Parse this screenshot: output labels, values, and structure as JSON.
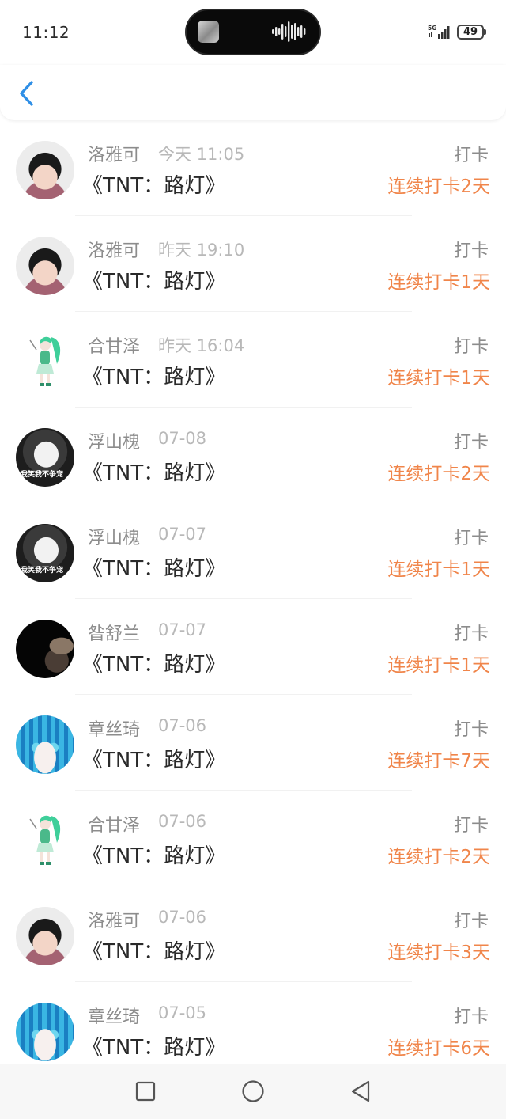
{
  "status_bar": {
    "time": "11:12",
    "network": "5G",
    "battery": "49"
  },
  "header": {
    "back_icon": "chevron-left-icon"
  },
  "colors": {
    "accent_blue": "#2f8fe6",
    "streak_orange": "#f0854a",
    "secondary_text": "#8c8c8c",
    "date_text": "#b8b8b8",
    "title_text": "#2a2a2a"
  },
  "records": [
    {
      "name": "洛雅可",
      "date": "今天 11:05",
      "title": "《TNT：路灯》",
      "action": "打卡",
      "streak": "连续打卡2天"
    },
    {
      "name": "洛雅可",
      "date": "昨天 19:10",
      "title": "《TNT：路灯》",
      "action": "打卡",
      "streak": "连续打卡1天"
    },
    {
      "name": "合甘泽",
      "date": "昨天 16:04",
      "title": "《TNT：路灯》",
      "action": "打卡",
      "streak": "连续打卡1天"
    },
    {
      "name": "浮山槐",
      "date": "07-08",
      "title": "《TNT：路灯》",
      "action": "打卡",
      "streak": "连续打卡2天"
    },
    {
      "name": "浮山槐",
      "date": "07-07",
      "title": "《TNT：路灯》",
      "action": "打卡",
      "streak": "连续打卡1天"
    },
    {
      "name": "昝舒兰",
      "date": "07-07",
      "title": "《TNT：路灯》",
      "action": "打卡",
      "streak": "连续打卡1天"
    },
    {
      "name": "章丝琦",
      "date": "07-06",
      "title": "《TNT：路灯》",
      "action": "打卡",
      "streak": "连续打卡7天"
    },
    {
      "name": "合甘泽",
      "date": "07-06",
      "title": "《TNT：路灯》",
      "action": "打卡",
      "streak": "连续打卡2天"
    },
    {
      "name": "洛雅可",
      "date": "07-06",
      "title": "《TNT：路灯》",
      "action": "打卡",
      "streak": "连续打卡3天"
    },
    {
      "name": "章丝琦",
      "date": "07-05",
      "title": "《TNT：路灯》",
      "action": "打卡",
      "streak": "连续打卡6天"
    }
  ],
  "avatar_captions": {
    "selfie": "我笑我不争宠"
  },
  "nav": {
    "recents_icon": "square-icon",
    "home_icon": "circle-icon",
    "back_icon": "triangle-back-icon"
  }
}
